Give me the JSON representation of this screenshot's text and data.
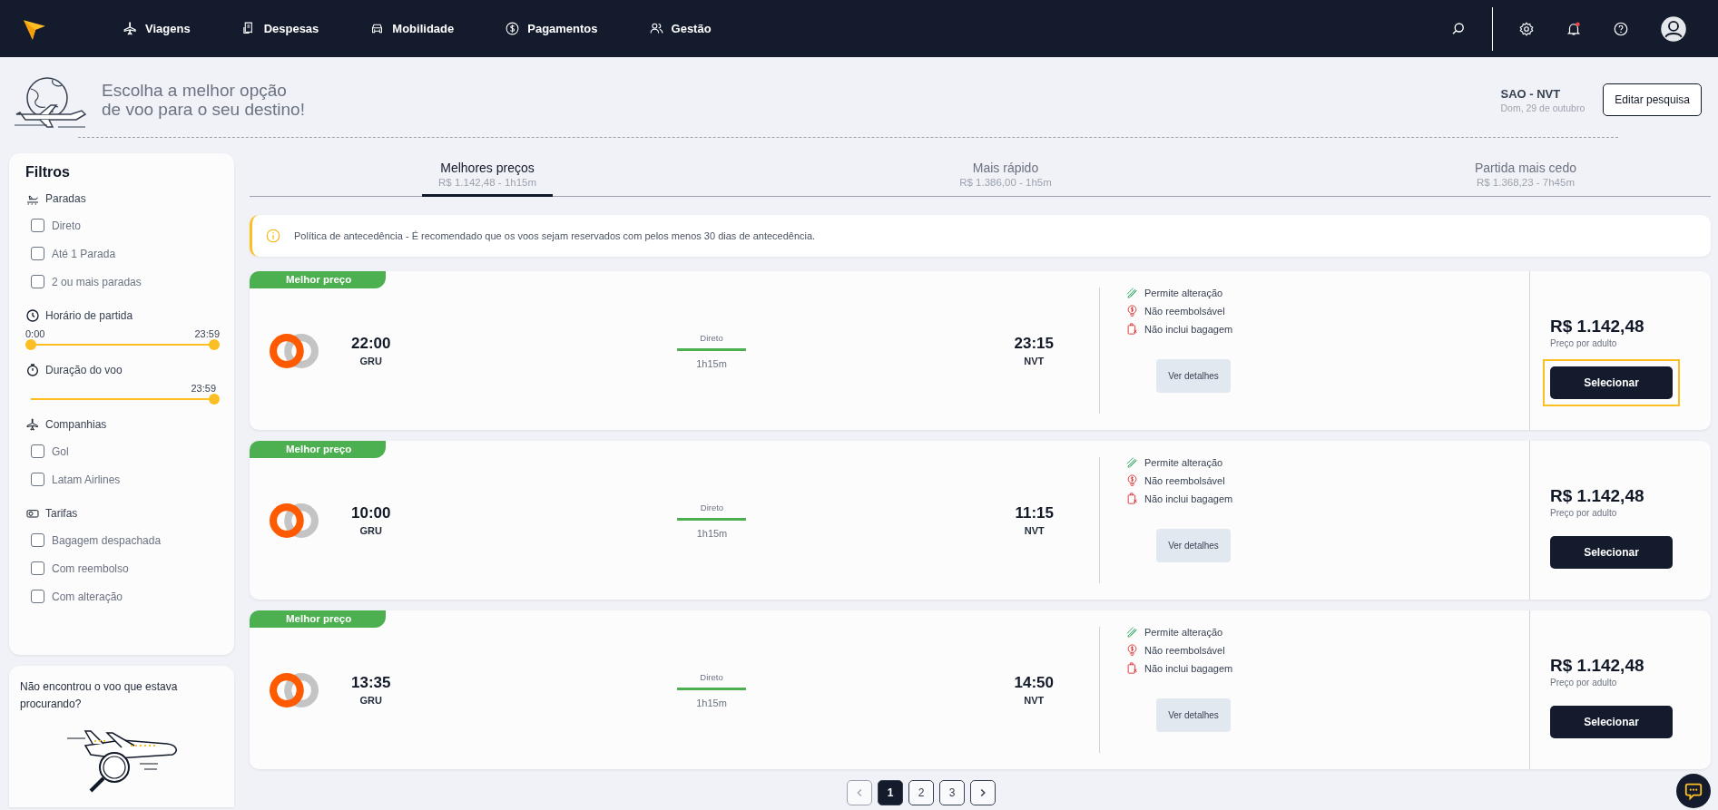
{
  "nav": {
    "items": [
      {
        "label": "Viagens"
      },
      {
        "label": "Despesas"
      },
      {
        "label": "Mobilidade"
      },
      {
        "label": "Pagamentos"
      },
      {
        "label": "Gestão"
      }
    ]
  },
  "header": {
    "headline_lines": [
      "Escolha a melhor opção",
      "de voo para o seu destino!"
    ],
    "route": "SAO - NVT",
    "date": "Dom, 29 de outubro",
    "edit_button": "Editar pesquisa"
  },
  "filters": {
    "title": "Filtros",
    "sections": [
      {
        "kind": "checkboxes",
        "title": "Paradas",
        "options": [
          {
            "label": "Direto",
            "checked": false
          },
          {
            "label": "Até 1 Parada",
            "checked": false
          },
          {
            "label": "2 ou mais paradas",
            "checked": false
          }
        ]
      },
      {
        "kind": "range",
        "title": "Horário de partida",
        "labels": [
          "0:00",
          "23:59"
        ],
        "thumbs": [
          {
            "level": 0
          },
          {
            "level": 1
          }
        ]
      },
      {
        "kind": "range",
        "title": "Duração do voo",
        "labels": [
          "23:59"
        ],
        "thumbs": [
          {
            "level": 1
          }
        ]
      },
      {
        "kind": "checkboxes",
        "title": "Companhias",
        "options": [
          {
            "label": "Gol",
            "checked": false
          },
          {
            "label": "Latam Airlines",
            "checked": false
          }
        ]
      },
      {
        "kind": "checkboxes",
        "title": "Tarifas",
        "options": [
          {
            "label": "Bagagem despachada",
            "checked": false
          },
          {
            "label": "Com reembolso",
            "checked": false
          },
          {
            "label": "Com alteração",
            "checked": false
          }
        ]
      }
    ]
  },
  "help_card": {
    "text": "Não encontrou o voo que estava procurando?"
  },
  "sort_tabs": [
    {
      "label": "Melhores preços",
      "summary": "R$ 1.142,48 - 1h15m",
      "selected": true
    },
    {
      "label": "Mais rápido",
      "summary": "R$ 1.386,00 - 1h5m",
      "selected": false
    },
    {
      "label": "Partida mais cedo",
      "summary": "R$ 1.368,23 - 7h45m",
      "selected": false
    }
  ],
  "notice": {
    "text": "Política de antecedência - É recomendado que os voos sejam reservados com pelos menos 30 dias de antecedência."
  },
  "flights": [
    {
      "badge": "Melhor preço",
      "departure_time": "22:00",
      "departure_airport": "GRU",
      "stops": "Direto",
      "duration": "1h15m",
      "arrival_time": "23:15",
      "arrival_airport": "NVT",
      "features": [
        {
          "kind": "change",
          "label": "Permite alteração"
        },
        {
          "kind": "refund",
          "label": "Não reembolsável"
        },
        {
          "kind": "baggage",
          "label": "Não inclui bagagem"
        }
      ],
      "details_button": "Ver detalhes",
      "price": "R$ 1.142,48",
      "price_note": "Preço por adulto",
      "select_button": "Selecionar",
      "focused": true
    },
    {
      "badge": "Melhor preço",
      "departure_time": "10:00",
      "departure_airport": "GRU",
      "stops": "Direto",
      "duration": "1h15m",
      "arrival_time": "11:15",
      "arrival_airport": "NVT",
      "features": [
        {
          "kind": "change",
          "label": "Permite alteração"
        },
        {
          "kind": "refund",
          "label": "Não reembolsável"
        },
        {
          "kind": "baggage",
          "label": "Não inclui bagagem"
        }
      ],
      "details_button": "Ver detalhes",
      "price": "R$ 1.142,48",
      "price_note": "Preço por adulto",
      "select_button": "Selecionar",
      "focused": false
    },
    {
      "badge": "Melhor preço",
      "departure_time": "13:35",
      "departure_airport": "GRU",
      "stops": "Direto",
      "duration": "1h15m",
      "arrival_time": "14:50",
      "arrival_airport": "NVT",
      "features": [
        {
          "kind": "change",
          "label": "Permite alteração"
        },
        {
          "kind": "refund",
          "label": "Não reembolsável"
        },
        {
          "kind": "baggage",
          "label": "Não inclui bagagem"
        }
      ],
      "details_button": "Ver detalhes",
      "price": "R$ 1.142,48",
      "price_note": "Preço por adulto",
      "select_button": "Selecionar",
      "focused": false
    }
  ],
  "pagination": {
    "prev_disabled": true,
    "pages": [
      {
        "label": "1",
        "selected": true
      },
      {
        "label": "2",
        "selected": false
      },
      {
        "label": "3",
        "selected": false
      }
    ]
  }
}
